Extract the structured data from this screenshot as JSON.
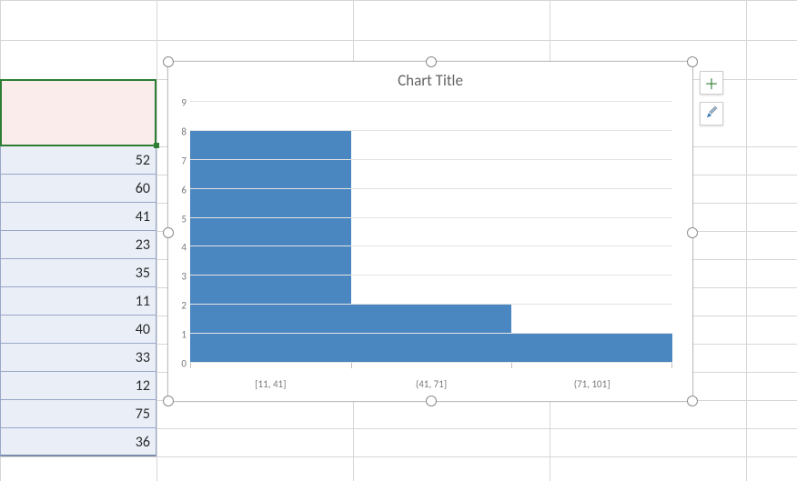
{
  "cells": [
    "",
    "52",
    "60",
    "41",
    "23",
    "35",
    "11",
    "40",
    "33",
    "12",
    "75",
    "36"
  ],
  "chart": {
    "title": "Chart Title"
  },
  "chart_data": {
    "type": "bar",
    "title": "Chart Title",
    "xlabel": "",
    "ylabel": "",
    "ylim": [
      0,
      9
    ],
    "y_ticks": [
      0,
      1,
      2,
      3,
      4,
      5,
      6,
      7,
      8,
      9
    ],
    "categories": [
      "[11, 41]",
      "(41, 71]",
      "(71, 101]"
    ],
    "values": [
      8,
      2,
      1
    ]
  },
  "side_buttons": {
    "add": {
      "glyph": "＋",
      "color": "#2e7d32"
    }
  }
}
